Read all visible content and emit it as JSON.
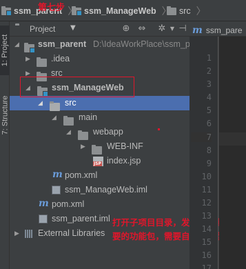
{
  "breadcrumb": {
    "items": [
      "ssm_parent",
      "ssm_ManageWeb",
      "src"
    ],
    "step_note": "第七步"
  },
  "tool_strip": {
    "tabs": [
      "1: Project",
      "7: Structure"
    ]
  },
  "project_panel": {
    "title": "Project",
    "dropdown_icon": "caret-down",
    "header_icons": [
      "globe-icon",
      "collapse-icon",
      "settings-icon",
      "hide-icon"
    ]
  },
  "tree": {
    "rows": [
      {
        "label": "ssm_parent",
        "path": "D:\\IdeaWorkPlace\\ssm_p",
        "icon": "module-folder",
        "expanded": true,
        "bold": true
      },
      {
        "label": ".idea",
        "icon": "folder",
        "expanded": false
      },
      {
        "label": "src",
        "icon": "folder",
        "expanded": false
      },
      {
        "label": "ssm_ManageWeb",
        "icon": "module-folder",
        "expanded": true,
        "bold": true
      },
      {
        "label": "src",
        "icon": "folder",
        "expanded": true,
        "selected": true
      },
      {
        "label": "main",
        "icon": "folder",
        "expanded": true
      },
      {
        "label": "webapp",
        "icon": "folder",
        "expanded": true
      },
      {
        "label": "WEB-INF",
        "icon": "folder",
        "expanded": false
      },
      {
        "label": "index.jsp",
        "icon": "jsp-file"
      },
      {
        "label": "pom.xml",
        "icon": "maven-file"
      },
      {
        "label": "ssm_ManageWeb.iml",
        "icon": "iml-file"
      },
      {
        "label": "pom.xml",
        "icon": "maven-file"
      },
      {
        "label": "ssm_parent.iml",
        "icon": "iml-file"
      },
      {
        "label": "External Libraries",
        "icon": "libraries-icon",
        "expanded": false
      }
    ]
  },
  "annotation": {
    "text": "打开子项目目录，发现不是我们需要的功能包，需要自定义类型",
    "color": "#e0162b"
  },
  "editor": {
    "tab_label": "ssm_pare",
    "line_numbers": [
      "1",
      "2",
      "3",
      "4",
      "5",
      "6",
      "7",
      "8",
      "9",
      "10",
      "11",
      "12",
      "13",
      "14",
      "15",
      "16",
      "17"
    ],
    "current_line": "7"
  },
  "colors": {
    "background": "#3c3f41",
    "selection": "#4b6eaf",
    "editor_bg": "#2b2b2b",
    "annotation_red": "#e0162b"
  }
}
